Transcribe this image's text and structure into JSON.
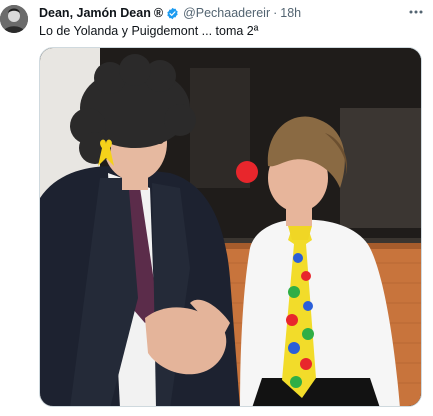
{
  "tweet": {
    "author_name": "Dean, Jamón Dean",
    "author_suffix": "®",
    "handle": "@Pechaadereir",
    "separator": "·",
    "timestamp": "18h",
    "text": "Lo de Yolanda y Puigdemont ... toma 2ª",
    "verified": true
  },
  "icons": {
    "avatar": "avatar",
    "verified": "verified-badge-icon",
    "more": "more-options-icon"
  },
  "colors": {
    "verified_blue": "#1d9bf0",
    "secondary_text": "#536471",
    "primary_text": "#0f1419"
  }
}
